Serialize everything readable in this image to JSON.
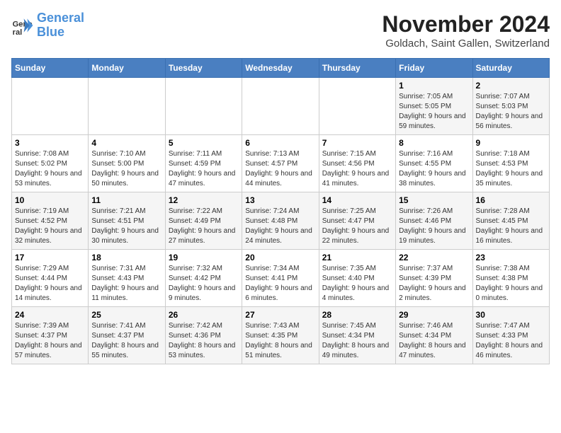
{
  "logo": {
    "line1": "General",
    "line2": "Blue"
  },
  "title": "November 2024",
  "subtitle": "Goldach, Saint Gallen, Switzerland",
  "weekdays": [
    "Sunday",
    "Monday",
    "Tuesday",
    "Wednesday",
    "Thursday",
    "Friday",
    "Saturday"
  ],
  "weeks": [
    [
      {
        "day": "",
        "info": ""
      },
      {
        "day": "",
        "info": ""
      },
      {
        "day": "",
        "info": ""
      },
      {
        "day": "",
        "info": ""
      },
      {
        "day": "",
        "info": ""
      },
      {
        "day": "1",
        "info": "Sunrise: 7:05 AM\nSunset: 5:05 PM\nDaylight: 9 hours and 59 minutes."
      },
      {
        "day": "2",
        "info": "Sunrise: 7:07 AM\nSunset: 5:03 PM\nDaylight: 9 hours and 56 minutes."
      }
    ],
    [
      {
        "day": "3",
        "info": "Sunrise: 7:08 AM\nSunset: 5:02 PM\nDaylight: 9 hours and 53 minutes."
      },
      {
        "day": "4",
        "info": "Sunrise: 7:10 AM\nSunset: 5:00 PM\nDaylight: 9 hours and 50 minutes."
      },
      {
        "day": "5",
        "info": "Sunrise: 7:11 AM\nSunset: 4:59 PM\nDaylight: 9 hours and 47 minutes."
      },
      {
        "day": "6",
        "info": "Sunrise: 7:13 AM\nSunset: 4:57 PM\nDaylight: 9 hours and 44 minutes."
      },
      {
        "day": "7",
        "info": "Sunrise: 7:15 AM\nSunset: 4:56 PM\nDaylight: 9 hours and 41 minutes."
      },
      {
        "day": "8",
        "info": "Sunrise: 7:16 AM\nSunset: 4:55 PM\nDaylight: 9 hours and 38 minutes."
      },
      {
        "day": "9",
        "info": "Sunrise: 7:18 AM\nSunset: 4:53 PM\nDaylight: 9 hours and 35 minutes."
      }
    ],
    [
      {
        "day": "10",
        "info": "Sunrise: 7:19 AM\nSunset: 4:52 PM\nDaylight: 9 hours and 32 minutes."
      },
      {
        "day": "11",
        "info": "Sunrise: 7:21 AM\nSunset: 4:51 PM\nDaylight: 9 hours and 30 minutes."
      },
      {
        "day": "12",
        "info": "Sunrise: 7:22 AM\nSunset: 4:49 PM\nDaylight: 9 hours and 27 minutes."
      },
      {
        "day": "13",
        "info": "Sunrise: 7:24 AM\nSunset: 4:48 PM\nDaylight: 9 hours and 24 minutes."
      },
      {
        "day": "14",
        "info": "Sunrise: 7:25 AM\nSunset: 4:47 PM\nDaylight: 9 hours and 22 minutes."
      },
      {
        "day": "15",
        "info": "Sunrise: 7:26 AM\nSunset: 4:46 PM\nDaylight: 9 hours and 19 minutes."
      },
      {
        "day": "16",
        "info": "Sunrise: 7:28 AM\nSunset: 4:45 PM\nDaylight: 9 hours and 16 minutes."
      }
    ],
    [
      {
        "day": "17",
        "info": "Sunrise: 7:29 AM\nSunset: 4:44 PM\nDaylight: 9 hours and 14 minutes."
      },
      {
        "day": "18",
        "info": "Sunrise: 7:31 AM\nSunset: 4:43 PM\nDaylight: 9 hours and 11 minutes."
      },
      {
        "day": "19",
        "info": "Sunrise: 7:32 AM\nSunset: 4:42 PM\nDaylight: 9 hours and 9 minutes."
      },
      {
        "day": "20",
        "info": "Sunrise: 7:34 AM\nSunset: 4:41 PM\nDaylight: 9 hours and 6 minutes."
      },
      {
        "day": "21",
        "info": "Sunrise: 7:35 AM\nSunset: 4:40 PM\nDaylight: 9 hours and 4 minutes."
      },
      {
        "day": "22",
        "info": "Sunrise: 7:37 AM\nSunset: 4:39 PM\nDaylight: 9 hours and 2 minutes."
      },
      {
        "day": "23",
        "info": "Sunrise: 7:38 AM\nSunset: 4:38 PM\nDaylight: 9 hours and 0 minutes."
      }
    ],
    [
      {
        "day": "24",
        "info": "Sunrise: 7:39 AM\nSunset: 4:37 PM\nDaylight: 8 hours and 57 minutes."
      },
      {
        "day": "25",
        "info": "Sunrise: 7:41 AM\nSunset: 4:37 PM\nDaylight: 8 hours and 55 minutes."
      },
      {
        "day": "26",
        "info": "Sunrise: 7:42 AM\nSunset: 4:36 PM\nDaylight: 8 hours and 53 minutes."
      },
      {
        "day": "27",
        "info": "Sunrise: 7:43 AM\nSunset: 4:35 PM\nDaylight: 8 hours and 51 minutes."
      },
      {
        "day": "28",
        "info": "Sunrise: 7:45 AM\nSunset: 4:34 PM\nDaylight: 8 hours and 49 minutes."
      },
      {
        "day": "29",
        "info": "Sunrise: 7:46 AM\nSunset: 4:34 PM\nDaylight: 8 hours and 47 minutes."
      },
      {
        "day": "30",
        "info": "Sunrise: 7:47 AM\nSunset: 4:33 PM\nDaylight: 8 hours and 46 minutes."
      }
    ]
  ]
}
